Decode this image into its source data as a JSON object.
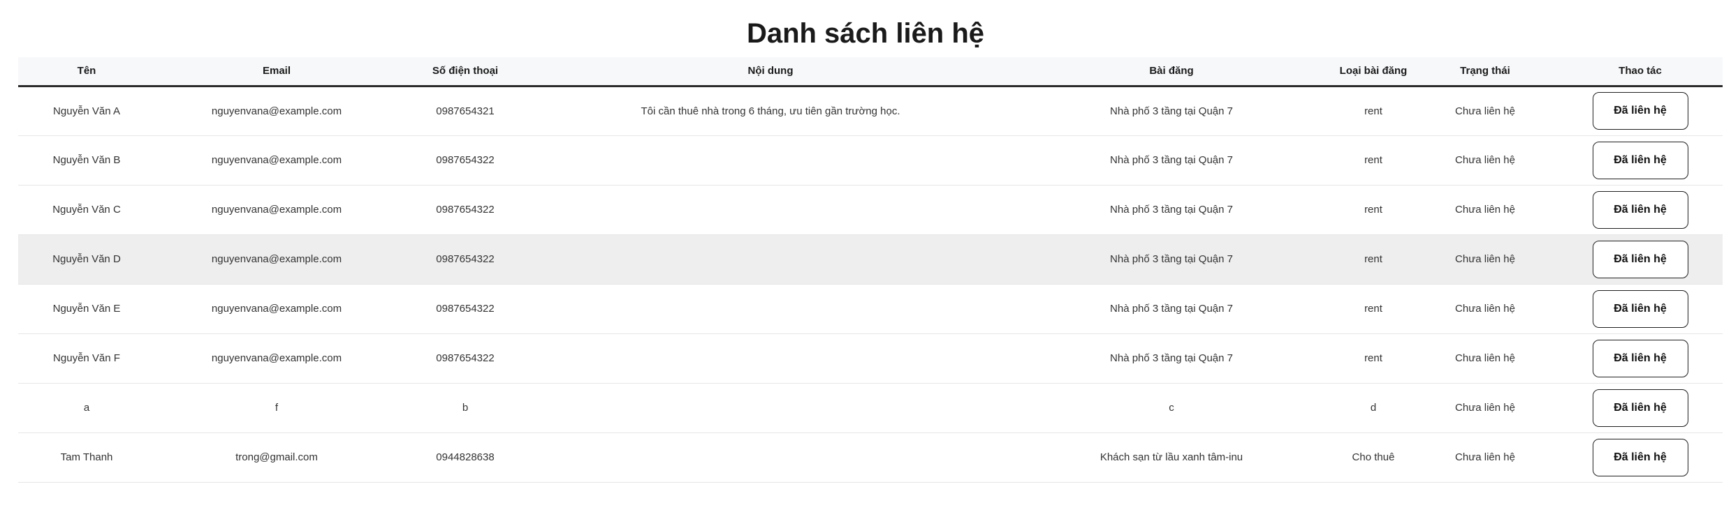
{
  "page": {
    "title": "Danh sách liên hệ"
  },
  "table": {
    "headers": [
      "Tên",
      "Email",
      "Số điện thoại",
      "Nội dung",
      "Bài đăng",
      "Loại bài đăng",
      "Trạng thái",
      "Thao tác"
    ],
    "rows": [
      {
        "name": "Nguyễn Văn A",
        "email": "nguyenvana@example.com",
        "phone": "0987654321",
        "content": "Tôi cần thuê nhà trong 6 tháng, ưu tiên gần trường học.",
        "post": "Nhà phố 3 tầng tại Quận 7",
        "post_type": "rent",
        "status": "Chưa liên hệ",
        "action": "Đã liên hệ"
      },
      {
        "name": "Nguyễn Văn B",
        "email": "nguyenvana@example.com",
        "phone": "0987654322",
        "content": "",
        "post": "Nhà phố 3 tầng tại Quận 7",
        "post_type": "rent",
        "status": "Chưa liên hệ",
        "action": "Đã liên hệ"
      },
      {
        "name": "Nguyễn Văn C",
        "email": "nguyenvana@example.com",
        "phone": "0987654322",
        "content": "",
        "post": "Nhà phố 3 tầng tại Quận 7",
        "post_type": "rent",
        "status": "Chưa liên hệ",
        "action": "Đã liên hệ"
      },
      {
        "name": "Nguyễn Văn D",
        "email": "nguyenvana@example.com",
        "phone": "0987654322",
        "content": "",
        "post": "Nhà phố 3 tầng tại Quận 7",
        "post_type": "rent",
        "status": "Chưa liên hệ",
        "action": "Đã liên hệ"
      },
      {
        "name": "Nguyễn Văn E",
        "email": "nguyenvana@example.com",
        "phone": "0987654322",
        "content": "",
        "post": "Nhà phố 3 tầng tại Quận 7",
        "post_type": "rent",
        "status": "Chưa liên hệ",
        "action": "Đã liên hệ"
      },
      {
        "name": "Nguyễn Văn F",
        "email": "nguyenvana@example.com",
        "phone": "0987654322",
        "content": "",
        "post": "Nhà phố 3 tầng tại Quận 7",
        "post_type": "rent",
        "status": "Chưa liên hệ",
        "action": "Đã liên hệ"
      },
      {
        "name": "a",
        "email": "f",
        "phone": "b",
        "content": "",
        "post": "c",
        "post_type": "d",
        "status": "Chưa liên hệ",
        "action": "Đã liên hệ"
      },
      {
        "name": "Tam Thanh",
        "email": "trong@gmail.com",
        "phone": "0944828638",
        "content": "",
        "post": "Khách sạn từ lầu xanh tâm-inu",
        "post_type": "Cho thuê",
        "status": "Chưa liên hệ",
        "action": "Đã liên hệ"
      }
    ]
  }
}
